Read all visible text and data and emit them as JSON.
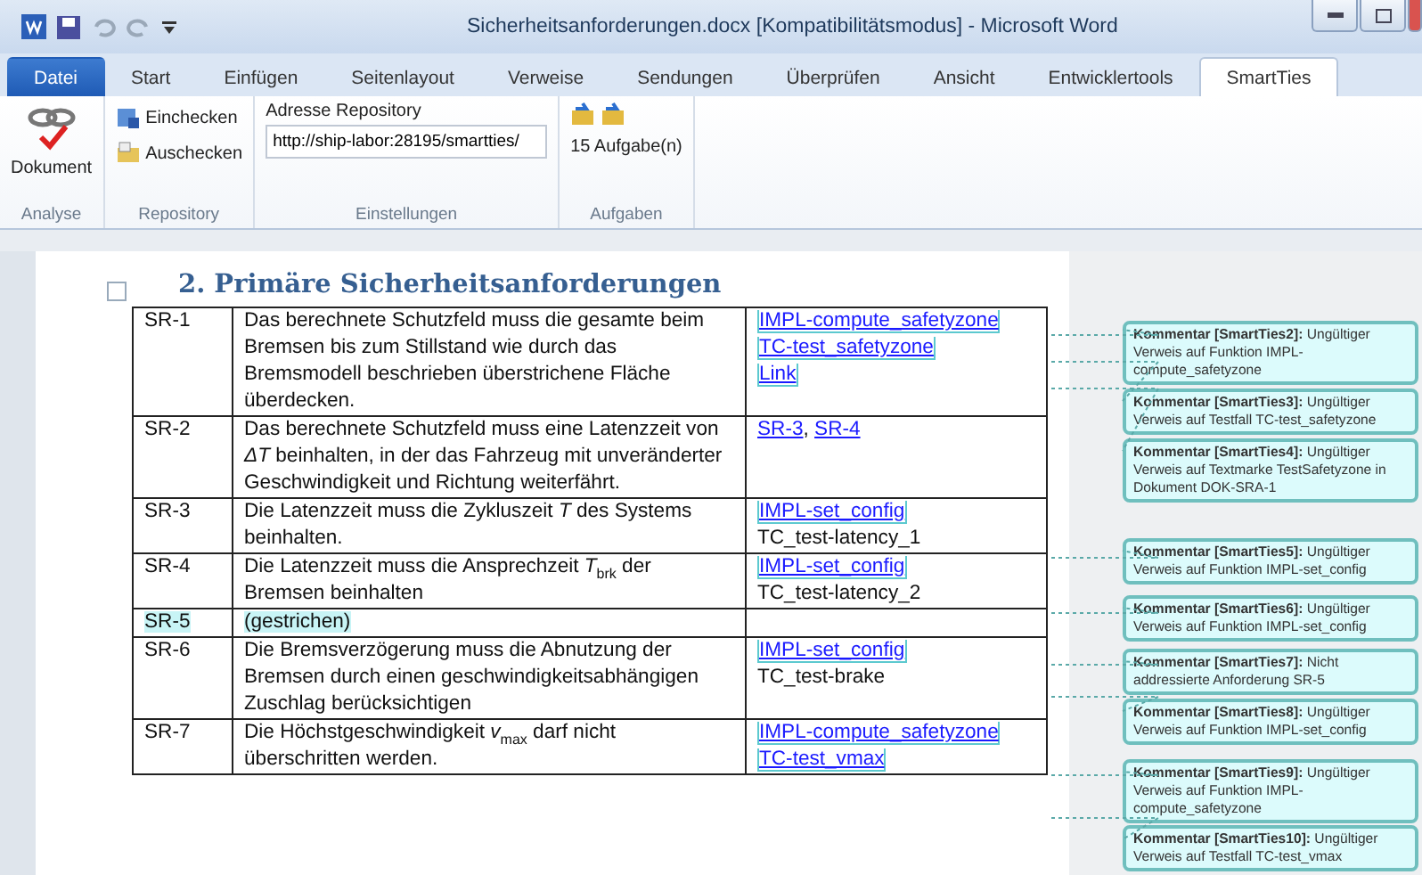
{
  "window": {
    "title": "Sicherheitsanforderungen.docx [Kompatibilitätsmodus] - Microsoft Word"
  },
  "tabs": [
    {
      "label": "Datei",
      "kind": "file",
      "selected": false
    },
    {
      "label": "Start",
      "kind": "tab",
      "selected": false
    },
    {
      "label": "Einfügen",
      "kind": "tab",
      "selected": false
    },
    {
      "label": "Seitenlayout",
      "kind": "tab",
      "selected": false
    },
    {
      "label": "Verweise",
      "kind": "tab",
      "selected": false
    },
    {
      "label": "Sendungen",
      "kind": "tab",
      "selected": false
    },
    {
      "label": "Überprüfen",
      "kind": "tab",
      "selected": false
    },
    {
      "label": "Ansicht",
      "kind": "tab",
      "selected": false
    },
    {
      "label": "Entwicklertools",
      "kind": "tab",
      "selected": false
    },
    {
      "label": "SmartTies",
      "kind": "tab",
      "selected": true
    }
  ],
  "ribbon": {
    "groups": [
      {
        "label": "Analyse",
        "kind": "analyse",
        "button": "Dokument"
      },
      {
        "label": "Repository",
        "kind": "repository",
        "buttons": [
          "Einchecken",
          "Auschecken"
        ]
      },
      {
        "label": "Einstellungen",
        "kind": "settings",
        "field_label": "Adresse Repository",
        "value": "http://ship-labor:28195/smartties/"
      },
      {
        "label": "Aufgaben",
        "kind": "tasks",
        "count": "15 Aufgabe(n)"
      }
    ]
  },
  "document": {
    "heading": "2.  Primäre Sicherheitsanforderungen",
    "rows": [
      {
        "id": "SR-1",
        "commented": false,
        "text": "Das berechnete Schutzfeld muss die gesamte beim Bremsen bis zum Stillstand wie durch das Bremsmodell beschrieben  überstrichene Fläche überdecken.",
        "refs": [
          [
            {
              "text": "IMPL-compute_safetyzone",
              "kind": "link"
            }
          ],
          [
            {
              "text": "TC-test_safetyzone",
              "kind": "link"
            }
          ],
          [
            {
              "text": "Link",
              "kind": "link"
            }
          ]
        ]
      },
      {
        "id": "SR-2",
        "commented": false,
        "text": "Das berechnete Schutzfeld muss eine Latenzzeit von *ΔT* beinhalten, in der das Fahrzeug mit unveränderter Geschwindigkeit und Richtung weiterfährt.",
        "refs": [
          [
            {
              "text": "SR-3",
              "kind": "ref"
            },
            {
              "text": ", ",
              "kind": "text"
            },
            {
              "text": "SR-4",
              "kind": "ref"
            }
          ]
        ]
      },
      {
        "id": "SR-3",
        "commented": false,
        "text": "Die Latenzzeit muss die Zykluszeit *T* des Systems beinhalten.",
        "refs": [
          [
            {
              "text": "IMPL-set_config",
              "kind": "link"
            }
          ],
          [
            {
              "text": "TC_test-latency_1",
              "kind": "text"
            }
          ]
        ]
      },
      {
        "id": "SR-4",
        "commented": false,
        "text": "Die Latenzzeit muss die Ansprechzeit *T*$_{brk}$ der Bremsen beinhalten",
        "refs": [
          [
            {
              "text": "IMPL-set_config",
              "kind": "link"
            }
          ],
          [
            {
              "text": " TC_test-latency_2",
              "kind": "text"
            }
          ]
        ]
      },
      {
        "id": "SR-5",
        "commented": true,
        "text": "(gestrichen)",
        "refs": []
      },
      {
        "id": "SR-6",
        "commented": false,
        "text": "Die Bremsverzögerung  muss  die Abnutzung der Bremsen durch einen geschwindigkeitsabhängigen Zuschlag berücksichtigen",
        "refs": [
          [
            {
              "text": "IMPL-set_config",
              "kind": "link"
            }
          ],
          [
            {
              "text": "TC_test-brake",
              "kind": "text"
            }
          ]
        ]
      },
      {
        "id": "SR-7",
        "commented": false,
        "text": "Die Höchstgeschwindigkeit *v*$_{max}$ darf nicht überschritten werden.",
        "refs": [
          [
            {
              "text": "IMPL-compute_safetyzone",
              "kind": "link"
            }
          ],
          [
            {
              "text": "TC-test_vmax",
              "kind": "link"
            }
          ]
        ]
      }
    ]
  },
  "comments": [
    {
      "text": "**Kommentar [SmartTies2]:** Ungültiger Verweis auf Funktion IMPL-compute_safetyzone"
    },
    {
      "text": "**Kommentar [SmartTies3]:** Ungültiger Verweis auf Testfall TC-test_safetyzone"
    },
    {
      "text": "**Kommentar [SmartTies4]:** Ungültiger Verweis auf Textmarke TestSafetyzone in Dokument DOK-SRA-1"
    },
    {
      "text": "**Kommentar [SmartTies5]:** Ungültiger Verweis auf Funktion IMPL-set_config"
    },
    {
      "text": "**Kommentar [SmartTies6]:** Ungültiger Verweis auf Funktion IMPL-set_config"
    },
    {
      "text": "**Kommentar [SmartTies7]:** Nicht addressierte Anforderung SR-5"
    },
    {
      "text": "**Kommentar [SmartTies8]:** Ungültiger Verweis auf Funktion IMPL-set_config"
    },
    {
      "text": "**Kommentar [SmartTies9]:** Ungültiger Verweis auf Funktion IMPL-compute_safetyzone"
    },
    {
      "text": "**Kommentar [SmartTies10]:** Ungültiger Verweis auf Testfall TC-test_vmax"
    }
  ]
}
